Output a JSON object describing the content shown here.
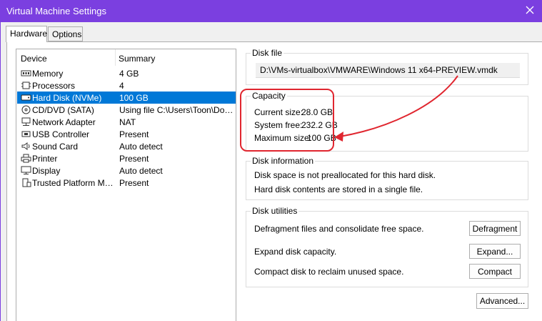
{
  "window": {
    "title": "Virtual Machine Settings",
    "close_icon": "close-icon"
  },
  "tabs": [
    {
      "label": "Hardware",
      "active": true
    },
    {
      "label": "Options",
      "active": false
    }
  ],
  "device_list": {
    "columns": {
      "device": "Device",
      "summary": "Summary"
    },
    "items": [
      {
        "icon": "memory-icon",
        "name": "Memory",
        "summary": "4 GB"
      },
      {
        "icon": "processor-icon",
        "name": "Processors",
        "summary": "4"
      },
      {
        "icon": "hard-disk-icon",
        "name": "Hard Disk (NVMe)",
        "summary": "100 GB",
        "selected": true
      },
      {
        "icon": "cd-dvd-icon",
        "name": "CD/DVD (SATA)",
        "summary": "Using file C:\\Users\\Toon\\Dow..."
      },
      {
        "icon": "network-adapter-icon",
        "name": "Network Adapter",
        "summary": "NAT"
      },
      {
        "icon": "usb-controller-icon",
        "name": "USB Controller",
        "summary": "Present"
      },
      {
        "icon": "sound-card-icon",
        "name": "Sound Card",
        "summary": "Auto detect"
      },
      {
        "icon": "printer-icon",
        "name": "Printer",
        "summary": "Present"
      },
      {
        "icon": "display-icon",
        "name": "Display",
        "summary": "Auto detect"
      },
      {
        "icon": "tpm-icon",
        "name": "Trusted Platform Mo...",
        "summary": "Present"
      }
    ]
  },
  "disk_file": {
    "legend": "Disk file",
    "path": "D:\\VMs-virtualbox\\VMWARE\\Windows 11 x64-PREVIEW.vmdk"
  },
  "capacity": {
    "legend": "Capacity",
    "current_size_label": "Current size:",
    "current_size_value": "28.0 GB",
    "system_free_label": "System free:",
    "system_free_value": "232.2 GB",
    "maximum_size_label": "Maximum size:",
    "maximum_size_value": "100 GB"
  },
  "disk_information": {
    "legend": "Disk information",
    "line1": "Disk space is not preallocated for this hard disk.",
    "line2": "Hard disk contents are stored in a single file."
  },
  "disk_utilities": {
    "legend": "Disk utilities",
    "defragment_text": "Defragment files and consolidate free space.",
    "defragment_button": "Defragment",
    "expand_text": "Expand disk capacity.",
    "expand_button": "Expand...",
    "compact_text": "Compact disk to reclaim unused space.",
    "compact_button": "Compact"
  },
  "advanced_button": "Advanced...",
  "colors": {
    "title_bar": "#7b3fe0",
    "selection": "#0078d7",
    "annotation_red": "#e0262f"
  }
}
